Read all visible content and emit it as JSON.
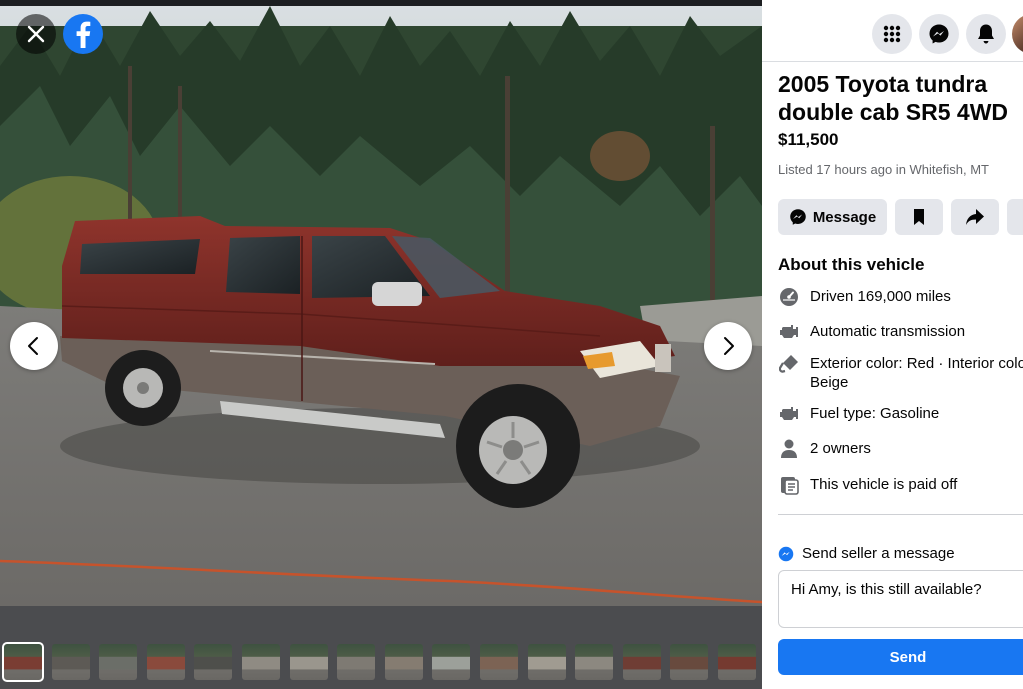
{
  "viewer": {
    "close_icon": "close-icon",
    "logo_icon": "facebook-logo-icon",
    "prev_icon": "chevron-left-icon",
    "next_icon": "chevron-right-icon",
    "thumbnail_count": 16,
    "active_thumbnail": 1
  },
  "header": {
    "icons": [
      "menu-grid-icon",
      "messenger-icon",
      "bell-icon",
      "avatar"
    ]
  },
  "listing": {
    "title": "2005 Toyota tundra double cab SR5 4WD",
    "price": "$11,500",
    "meta": "Listed 17 hours ago in Whitefish, MT"
  },
  "actions": {
    "message_label": "Message",
    "save_icon": "bookmark-icon",
    "share_icon": "share-icon",
    "more_icon": "more-icon"
  },
  "about": {
    "heading": "About this vehicle",
    "details": [
      {
        "icon": "speedometer-icon",
        "text": "Driven 169,000 miles"
      },
      {
        "icon": "engine-icon",
        "text": "Automatic transmission"
      },
      {
        "icon": "paint-icon",
        "text": "Exterior color: Red · Interior color: Beige"
      },
      {
        "icon": "fuel-icon",
        "text": "Fuel type: Gasoline"
      },
      {
        "icon": "person-icon",
        "text": "2 owners"
      },
      {
        "icon": "receipt-icon",
        "text": "This vehicle is paid off"
      }
    ]
  },
  "seller_message": {
    "heading": "Send seller a message",
    "input_value": "Hi Amy, is this still available?",
    "send_label": "Send"
  },
  "colors": {
    "facebook_blue": "#1877f2",
    "button_gray": "#e4e6eb",
    "secondary_text": "#65676b",
    "truck_red": "#7e2a24"
  }
}
